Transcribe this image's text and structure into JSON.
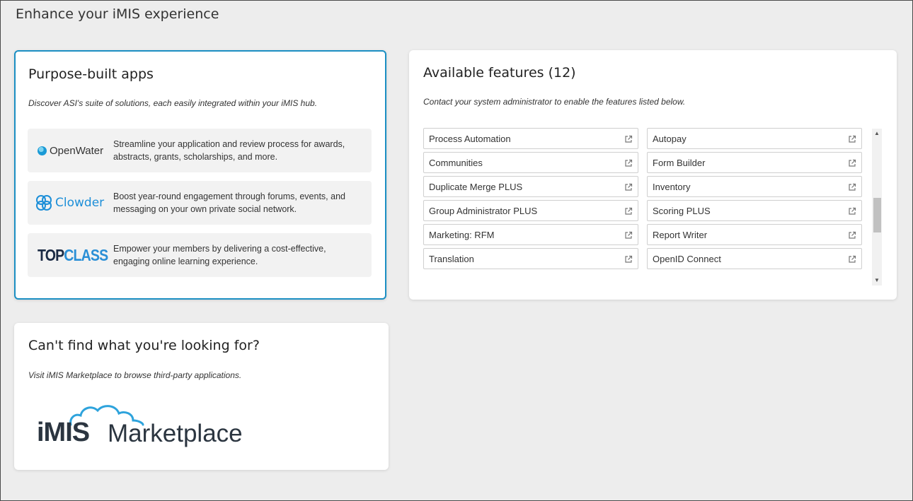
{
  "page": {
    "title": "Enhance your iMIS experience"
  },
  "apps": {
    "title": "Purpose-built apps",
    "description": "Discover ASI's suite of solutions, each easily integrated within your iMIS hub.",
    "items": [
      {
        "logo_text": "OpenWater",
        "logo_icon": "openwater-icon",
        "text": "Streamline your application and review process for awards, abstracts, grants, scholarships, and more."
      },
      {
        "logo_text": "Clowder",
        "logo_icon": "clowder-icon",
        "text": "Boost year-round engagement through forums, events, and messaging on your own private social network."
      },
      {
        "logo_top": "TOP",
        "logo_class": "CLASS",
        "text": "Empower your members by delivering a cost-effective, engaging online learning experience."
      }
    ]
  },
  "features": {
    "title": "Available features (12)",
    "description": "Contact your system administrator to enable the features listed below.",
    "items": [
      "Process Automation",
      "Autopay",
      "Communities",
      "Form Builder",
      "Duplicate Merge PLUS",
      "Inventory",
      "Group Administrator PLUS",
      "Scoring PLUS",
      "Marketing: RFM",
      "Report Writer",
      "Translation",
      "OpenID Connect"
    ],
    "item_icon": "external-link-icon",
    "scroll_up": "▲",
    "scroll_down": "▼"
  },
  "marketplace": {
    "title": "Can't find what you're looking for?",
    "description": "Visit iMIS Marketplace to browse third-party applications.",
    "logo_imis": "iMIS",
    "logo_marketplace": "Marketplace",
    "logo_icon": "cloud-icon"
  },
  "colors": {
    "accent_border": "#1b8fc3",
    "clowder": "#1d8fd8",
    "topclass_class": "#2a8fd6",
    "cloud": "#2ea3dc"
  }
}
